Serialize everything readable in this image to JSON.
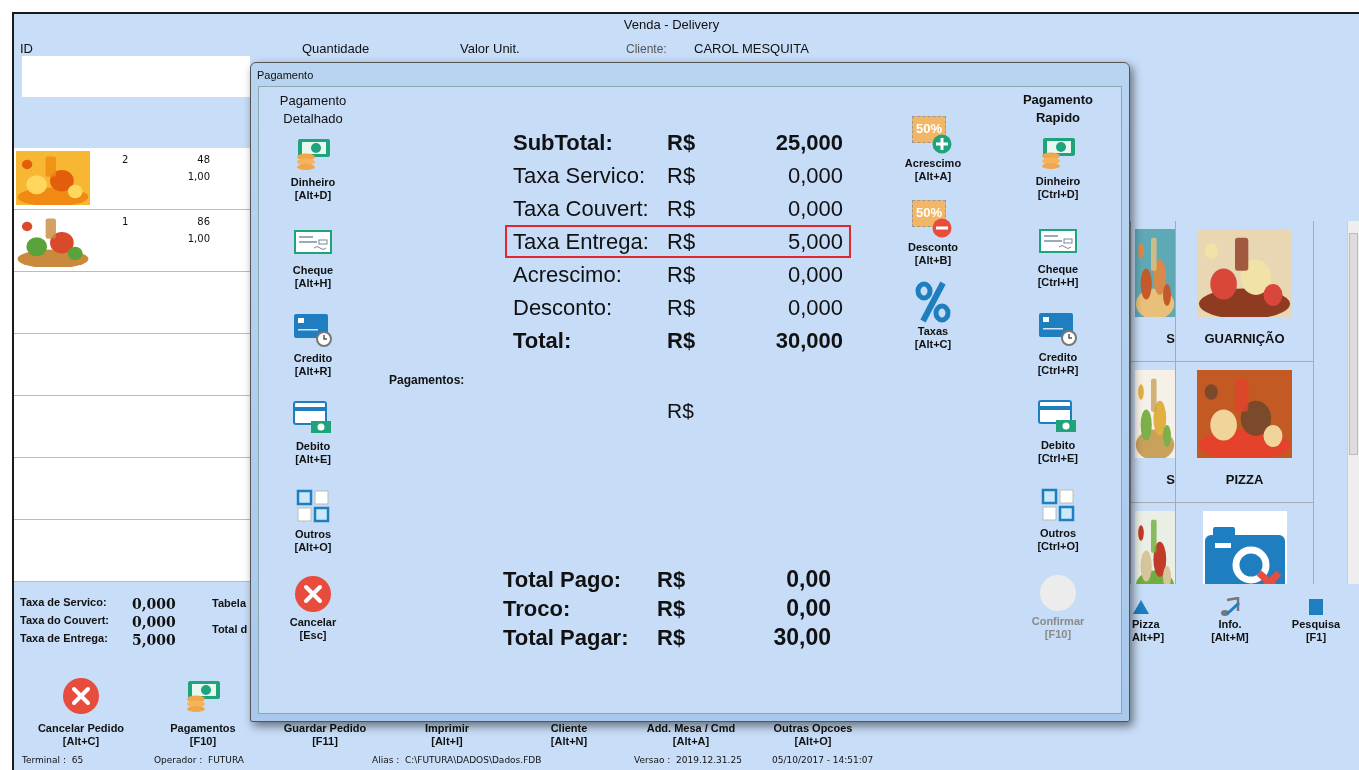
{
  "window": {
    "title": "Venda - Delivery"
  },
  "header": {
    "columns": [
      "ID",
      "Quantidade",
      "Valor Unit."
    ],
    "client_label": "Cliente:",
    "client": "CAROL MESQUITA"
  },
  "items": [
    {
      "quantity": "2",
      "code": "48",
      "price": "1,00"
    },
    {
      "quantity": "1",
      "code": "86",
      "price": "1,00"
    }
  ],
  "categories": [
    {
      "name": "S"
    },
    {
      "name": "GUARNIÇÃO"
    },
    {
      "name": "S"
    },
    {
      "name": "PIZZA"
    },
    {
      "kind": "picture"
    },
    {
      "kind": "no_image"
    }
  ],
  "fees": [
    {
      "label": "Taxa de Servico:",
      "value": "0,000"
    },
    {
      "label": "Taxa do Couvert:",
      "value": "0,000"
    },
    {
      "label": "Taxa de Entrega:",
      "value": "5,000"
    }
  ],
  "fees_side": [
    "Tabela",
    "Total d"
  ],
  "actions": [
    {
      "label": "Cancelar Pedido",
      "shortcut": "[Alt+C]",
      "kind": "cancel"
    },
    {
      "label": "Pagamentos",
      "shortcut": "[F10]",
      "kind": "cash"
    },
    {
      "label": "Guardar Pedido",
      "shortcut": "[F11]"
    },
    {
      "label": "Imprimir",
      "shortcut": "[Alt+I]"
    },
    {
      "label": "Cliente",
      "shortcut": "[Alt+N]"
    },
    {
      "label": "Add. Mesa / Cmd",
      "shortcut": "[Alt+A]"
    },
    {
      "label": "Outras Opcoes",
      "shortcut": "[Alt+O]"
    }
  ],
  "side_actions": [
    {
      "label": "Pizza",
      "shortcut": "Alt+P]",
      "kind": "triangle"
    },
    {
      "label": "Info.",
      "shortcut": "[Alt+M]",
      "kind": "music"
    },
    {
      "label": "Pesquisa",
      "shortcut": "[F1]",
      "kind": "square"
    }
  ],
  "status_bar": [
    "Terminal :  65",
    "Operador :  FUTURA",
    "Alias :  C:\\FUTURA\\DADOS\\Dados.FDB",
    "Versao :  2019.12.31.25",
    "05/10/2017 - 14:51:07"
  ],
  "dialog": {
    "title": "Pagamento",
    "detailed": {
      "heading": "Pagamento Detalhado",
      "buttons": [
        {
          "label": "Dinheiro",
          "shortcut": "[Alt+D]",
          "kind": "cash"
        },
        {
          "label": "Cheque",
          "shortcut": "[Alt+H]",
          "kind": "cheque"
        },
        {
          "label": "Credito",
          "shortcut": "[Alt+R]",
          "kind": "credit"
        },
        {
          "label": "Debito",
          "shortcut": "[Alt+E]",
          "kind": "debit"
        },
        {
          "label": "Outros",
          "shortcut": "[Alt+O]",
          "kind": "others"
        },
        {
          "label": "Cancelar",
          "shortcut": "[Esc]",
          "kind": "cancel"
        }
      ]
    },
    "summary": [
      {
        "label": "SubTotal:",
        "currency": "R$",
        "value": "25,000",
        "bold": true,
        "highlighted": false
      },
      {
        "label": "Taxa Servico:",
        "currency": "R$",
        "value": "0,000",
        "bold": false,
        "highlighted": false
      },
      {
        "label": "Taxa Couvert:",
        "currency": "R$",
        "value": "0,000",
        "bold": false,
        "highlighted": false
      },
      {
        "label": "Taxa Entrega:",
        "currency": "R$",
        "value": "5,000",
        "bold": false,
        "highlighted": true
      },
      {
        "label": "Acrescimo:",
        "currency": "R$",
        "value": "0,000",
        "bold": false,
        "highlighted": false
      },
      {
        "label": "Desconto:",
        "currency": "R$",
        "value": "0,000",
        "bold": false,
        "highlighted": false
      },
      {
        "label": "Total:",
        "currency": "R$",
        "value": "30,000",
        "bold": true,
        "highlighted": false
      }
    ],
    "payments_label": "Pagamentos:",
    "payments_currency": "R$",
    "final": [
      {
        "label": "Total Pago:",
        "currency": "R$",
        "value": "0,00"
      },
      {
        "label": "Troco:",
        "currency": "R$",
        "value": "0,00"
      },
      {
        "label": "Total Pagar:",
        "currency": "R$",
        "value": "30,00"
      }
    ],
    "adjustments": [
      {
        "label": "Acrescimo",
        "shortcut": "[Alt+A]",
        "kind": "plus",
        "tag": "50%"
      },
      {
        "label": "Desconto",
        "shortcut": "[Alt+B]",
        "kind": "minus",
        "tag": "50%"
      },
      {
        "label": "Taxas",
        "shortcut": "[Alt+C]",
        "kind": "percent"
      }
    ],
    "quick": {
      "heading": "Pagamento Rapido",
      "buttons": [
        {
          "label": "Dinheiro",
          "shortcut": "[Ctrl+D]",
          "kind": "cash",
          "disabled": false
        },
        {
          "label": "Cheque",
          "shortcut": "[Ctrl+H]",
          "kind": "cheque",
          "disabled": false
        },
        {
          "label": "Credito",
          "shortcut": "[Ctrl+R]",
          "kind": "credit",
          "disabled": false
        },
        {
          "label": "Debito",
          "shortcut": "[Ctrl+E]",
          "kind": "debit",
          "disabled": false
        },
        {
          "label": "Outros",
          "shortcut": "[Ctrl+O]",
          "kind": "others",
          "disabled": false
        },
        {
          "label": "Confirmar",
          "shortcut": "[F10]",
          "kind": "circle",
          "disabled": true
        }
      ]
    }
  }
}
